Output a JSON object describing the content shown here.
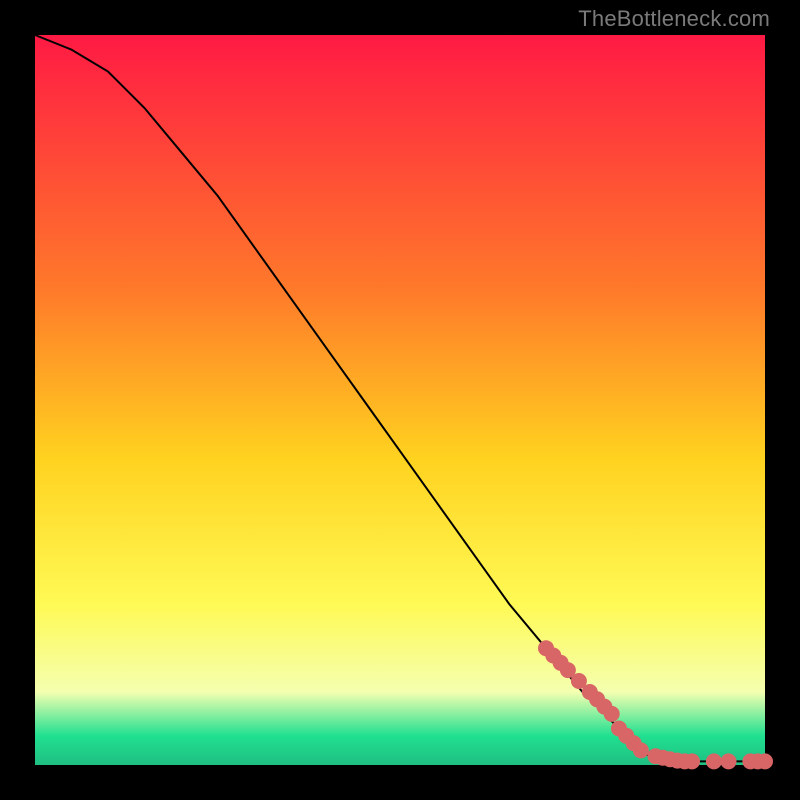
{
  "attribution": "TheBottleneck.com",
  "colors": {
    "black": "#000000",
    "curve": "#000000",
    "marker": "#d96666",
    "grad_top": "#ff1a44",
    "grad_mid1": "#ff7a2a",
    "grad_mid2": "#ffd21f",
    "grad_mid3": "#fffa55",
    "grad_mid4": "#f4ffb0",
    "grad_green": "#20e090",
    "grad_bottom": "#1fbf82"
  },
  "chart_data": {
    "type": "line",
    "title": "",
    "xlabel": "",
    "ylabel": "",
    "xlim": [
      0,
      100
    ],
    "ylim": [
      0,
      100
    ],
    "series": [
      {
        "name": "bottleneck-curve",
        "x": [
          0,
          5,
          10,
          15,
          20,
          25,
          30,
          35,
          40,
          45,
          50,
          55,
          60,
          65,
          70,
          75,
          80,
          82,
          85,
          88,
          92,
          96,
          100
        ],
        "y": [
          100,
          98,
          95,
          90,
          84,
          78,
          71,
          64,
          57,
          50,
          43,
          36,
          29,
          22,
          16,
          10,
          5,
          2,
          1,
          0.5,
          0.5,
          0.5,
          0.5
        ]
      }
    ],
    "markers": {
      "name": "highlight-points",
      "x": [
        70,
        71,
        72,
        73,
        74.5,
        76,
        77,
        78,
        79,
        80,
        81,
        82,
        83,
        85,
        86,
        87,
        88,
        89,
        90,
        93,
        95,
        98,
        99,
        100
      ],
      "y": [
        16,
        15,
        14,
        13,
        11.5,
        10,
        9,
        8,
        7,
        5,
        4,
        3,
        2,
        1.2,
        1,
        0.8,
        0.6,
        0.5,
        0.5,
        0.5,
        0.5,
        0.5,
        0.5,
        0.5
      ]
    }
  }
}
